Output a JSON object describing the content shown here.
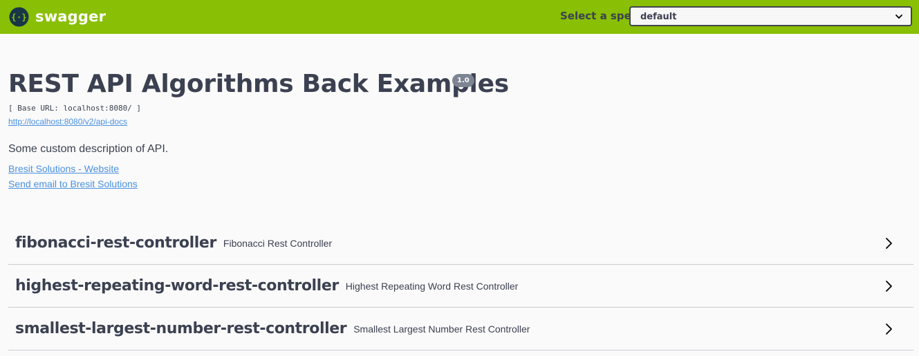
{
  "topbar": {
    "logo_text": "swagger",
    "logo_icon": "swagger-braces-icon",
    "spec_label": "Select a spec",
    "spec_selected": "default",
    "bg_color": "#89bf04"
  },
  "info": {
    "title": "REST API Algorithms Back Examples",
    "version": "1.0",
    "base_url": "[ Base URL: localhost:8080/ ]",
    "api_docs_url": "http://localhost:8080/v2/api-docs",
    "description": "Some custom description of API.",
    "website_link": "Bresit Solutions - Website",
    "email_link": "Send email to Bresit Solutions"
  },
  "tags": [
    {
      "name": "fibonacci-rest-controller",
      "description": "Fibonacci Rest Controller"
    },
    {
      "name": "highest-repeating-word-rest-controller",
      "description": "Highest Repeating Word Rest Controller"
    },
    {
      "name": "smallest-largest-number-rest-controller",
      "description": "Smallest Largest Number Rest Controller"
    }
  ],
  "colors": {
    "text": "#3b4151",
    "link": "#4990e2",
    "version_badge": "#7d8492"
  }
}
